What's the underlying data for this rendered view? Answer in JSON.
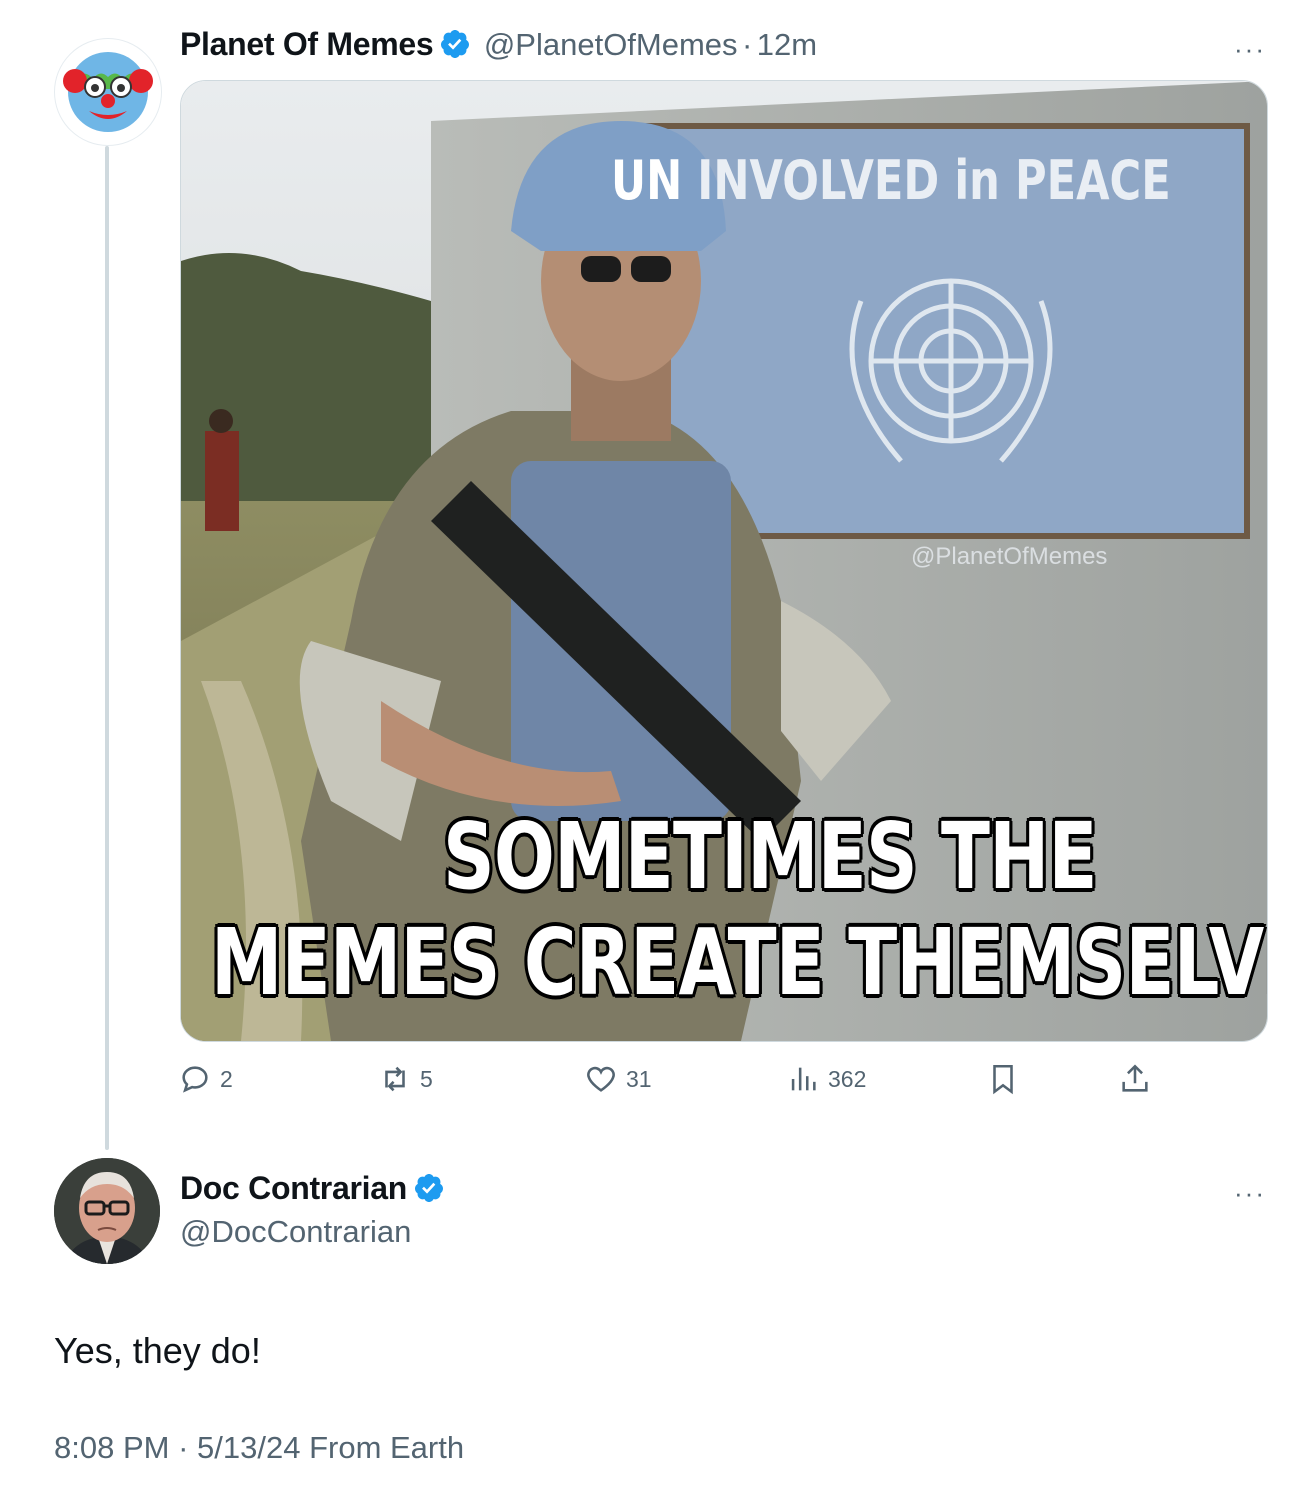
{
  "original_tweet": {
    "display_name": "Planet Of Memes",
    "handle": "@PlanetOfMemes",
    "separator": "·",
    "time": "12m",
    "more_label": "···",
    "media": {
      "top_text": "UN INVOLVED in PEACE",
      "top_text_un": "UN",
      "top_text_rest": "INVOLVED in PEACE",
      "watermark": "@PlanetOfMemes",
      "caption_line1": "SOMETIMES THE",
      "caption_line2": "MEMES CREATE THEMSELVES"
    },
    "actions": {
      "replies": "2",
      "reposts": "5",
      "likes": "31",
      "views": "362"
    }
  },
  "reply_tweet": {
    "display_name": "Doc Contrarian",
    "handle": "@DocContrarian",
    "more_label": "···",
    "text": "Yes, they do!",
    "time": "8:08 PM",
    "separator": "·",
    "date_source": "5/13/24 From Earth"
  },
  "colors": {
    "verified_blue": "#1d9bf0",
    "muted_text": "#536471",
    "thread_line": "#cfd9de"
  }
}
